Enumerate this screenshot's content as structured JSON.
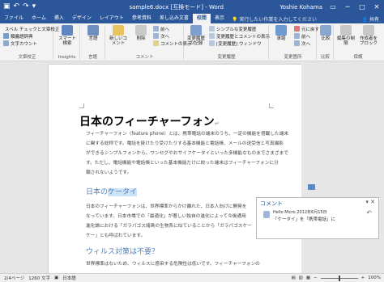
{
  "titlebar": {
    "title": "sample6.docx [互換モード] - Word",
    "user": "Yoshie Kohama",
    "icons": [
      "save-icon",
      "undo-icon",
      "redo-icon",
      "customize-icon"
    ],
    "controls": [
      "restore-icon",
      "minimize-icon",
      "maximize-icon",
      "close-icon"
    ]
  },
  "tabs": [
    "ファイル",
    "ホーム",
    "挿入",
    "デザイン",
    "レイアウト",
    "参考資料",
    "差し込み文書",
    "校閲",
    "表示"
  ],
  "active_tab": "校閲",
  "tellme": "実行したい作業を入力してください",
  "share": "共有",
  "ribbon": {
    "proofing": {
      "items": [
        "スペル チェックと文章校正",
        "類義語辞典",
        "文字カウント"
      ],
      "label": "文章校正"
    },
    "insights": {
      "button": "スマート検索",
      "label": "Insights"
    },
    "language": {
      "button": "言語",
      "label": "言語"
    },
    "comments": {
      "new": "新しいコメント",
      "delete": "削除",
      "items": [
        "前へ",
        "次へ",
        "コメントの表示"
      ],
      "label": "コメント"
    },
    "tracking": {
      "button": "変更履歴の記録",
      "items": [
        "シンプルな変更履歴",
        "変更履歴とコメントの表示",
        "[変更履歴] ウィンドウ"
      ],
      "label": "変更履歴"
    },
    "changes": {
      "accept": "承諾",
      "items": [
        "元に戻す",
        "前へ",
        "次へ"
      ],
      "label": "変更箇所"
    },
    "compare": {
      "button": "比較",
      "label": "比較"
    },
    "protect": {
      "block": "編集の制限",
      "restrict": "作成者をブロック",
      "label": "保護"
    }
  },
  "document": {
    "heading": "日本のフィーチャーフォン",
    "para1": [
      "フィーチャーフォン（feature phone）とは、携帯電話の端末のうち、一定の機能を搭載した端末",
      "に関する総称です。電話を掛けたり受けたりする基本機能と電話帳、メールの送受信と写真撮影",
      "ができるシンプルフォンから、ワンセグやおサイフケータイといった多機能なものまでさまざまで",
      "す。ただし、電話機能や電話帳といった基本機能だけに絞った端末はフィーチャーフォンに分",
      "類されないようです。"
    ],
    "heading2_prefix": "日本の",
    "heading2_highlight": "ケータイ",
    "para2": [
      "日本のフィーチャーフォンは、世界標準からかけ離れた、日本人向けに開発を",
      "なっています。日本市場での「最適化」が著しい独自の進化によって今後通用",
      "進化論における「ガラパゴス諸島の生物系に似ていることから「ガラパゴスケー",
      "ケー」とも呼ばれています。"
    ],
    "heading3": "ウィルス対策は不要？",
    "para3": "世界標準はないため、ウィルスに感染する危険性は低いです。フィーチャーフォンの"
  },
  "comment": {
    "title": "コメント",
    "author": "Hello Micro 2012年6月15日",
    "text": "「ケータイ」を「携帯電話」に"
  },
  "status": {
    "page": "2/4ページ",
    "words": "1260 文字",
    "language": "日本語",
    "zoom": "100%"
  }
}
